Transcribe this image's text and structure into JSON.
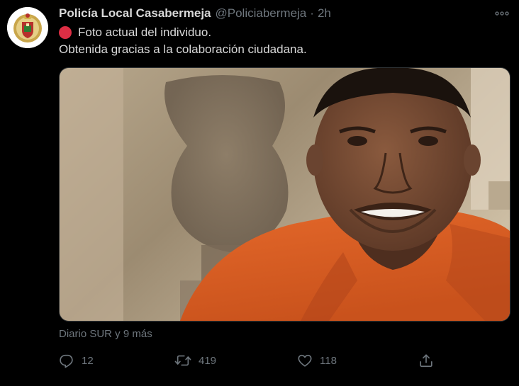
{
  "tweet": {
    "author_name": "Policía Local Casabermeja",
    "author_handle": "@Policiabermeja",
    "separator": "·",
    "time": "2h",
    "text_line1": "Foto actual del individuo.",
    "text_line2": "Obtenida gracias a la colaboración ciudadana.",
    "emoji_icon": "red-circle-emoji",
    "media_credit": "Diario SUR y 9 más",
    "stats": {
      "replies": "12",
      "retweets": "419",
      "likes": "118"
    }
  },
  "colors": {
    "background": "#000000",
    "primary_text": "#d9d9d9",
    "secondary_text": "#6e767d",
    "border": "#2f3336",
    "emoji_red": "#dd2e44"
  },
  "icons": {
    "more": "more-horizontal-icon",
    "reply": "reply-icon",
    "retweet": "retweet-icon",
    "like": "heart-icon",
    "share": "share-icon"
  }
}
